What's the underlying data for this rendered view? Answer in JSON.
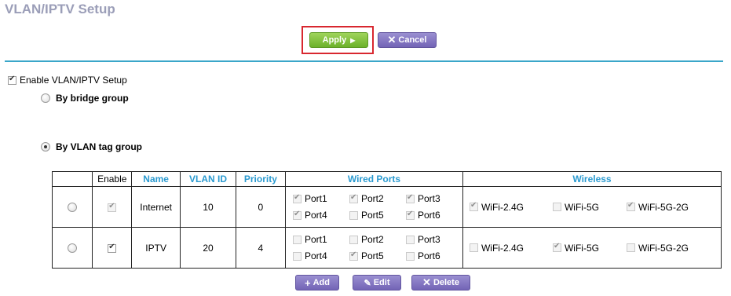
{
  "page": {
    "title": "VLAN/IPTV Setup"
  },
  "toolbar": {
    "apply_label": "Apply",
    "cancel_label": "Cancel"
  },
  "settings": {
    "enable_label": "Enable VLAN/IPTV Setup",
    "enable_checked": true,
    "bridge_label": "By bridge group",
    "vlan_tag_label": "By VLAN tag group",
    "selected_mode": "By VLAN tag group"
  },
  "table": {
    "headers": {
      "enable": "Enable",
      "name": "Name",
      "vlan_id": "VLAN ID",
      "priority": "Priority",
      "wired": "Wired Ports",
      "wireless": "Wireless"
    },
    "rows": [
      {
        "name": "Internet",
        "vlan_id": "10",
        "priority": "0",
        "enable_checked": true,
        "enable_disabled": true,
        "ports": [
          {
            "label": "Port1",
            "checked": true
          },
          {
            "label": "Port2",
            "checked": true
          },
          {
            "label": "Port3",
            "checked": true
          },
          {
            "label": "Port4",
            "checked": true
          },
          {
            "label": "Port5",
            "checked": false
          },
          {
            "label": "Port6",
            "checked": true
          }
        ],
        "wireless": [
          {
            "label": "WiFi-2.4G",
            "checked": true
          },
          {
            "label": "WiFi-5G",
            "checked": false
          },
          {
            "label": "WiFi-5G-2G",
            "checked": true
          }
        ]
      },
      {
        "name": "IPTV",
        "vlan_id": "20",
        "priority": "4",
        "enable_checked": true,
        "enable_disabled": false,
        "ports": [
          {
            "label": "Port1",
            "checked": false
          },
          {
            "label": "Port2",
            "checked": false
          },
          {
            "label": "Port3",
            "checked": false
          },
          {
            "label": "Port4",
            "checked": false
          },
          {
            "label": "Port5",
            "checked": true
          },
          {
            "label": "Port6",
            "checked": false
          }
        ],
        "wireless": [
          {
            "label": "WiFi-2.4G",
            "checked": false
          },
          {
            "label": "WiFi-5G",
            "checked": true
          },
          {
            "label": "WiFi-5G-2G",
            "checked": false
          }
        ]
      }
    ]
  },
  "actions": {
    "add_label": "Add",
    "edit_label": "Edit",
    "delete_label": "Delete"
  },
  "colors": {
    "accent": "#3aa6c9",
    "header_text": "#2a9ad0",
    "apply": "#7bbf36",
    "purple": "#7f71bf",
    "highlight_frame": "#d8272f"
  }
}
